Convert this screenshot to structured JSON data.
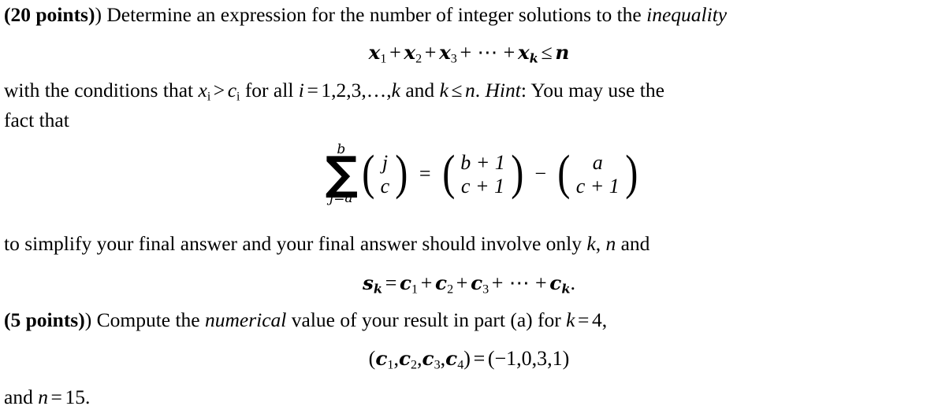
{
  "document": {
    "type": "math-problem-statement",
    "background_color": "#ffffff",
    "text_color": "#000000"
  },
  "part_a": {
    "points_label": "(20 points)",
    "points_bold_text": "20 points",
    "intro_before_emphasis": ") Determine an expression for the number of integer solutions to the ",
    "emphasis": "inequality",
    "inequality": {
      "terms": [
        "x",
        "x",
        "x"
      ],
      "subscripts": [
        "1",
        "2",
        "3"
      ],
      "ellipsis": "⋯",
      "last_term": "x",
      "last_subscript": "k",
      "relation": "≤",
      "bound": "n",
      "plain": "x₁ + x₂ + x₃ + ⋯ + xₖ ≤ n"
    },
    "conditions_line": {
      "segment_1": "with the conditions that ",
      "var_x": "x",
      "sub_x": "i",
      "rel_1": ">",
      "var_c": "c",
      "sub_c": "i",
      "segment_2": " for all ",
      "var_i": "i",
      "eq": "=",
      "index_list": "1,2,3,…,",
      "var_k": "k",
      "segment_3": " and ",
      "var_k2": "k",
      "rel_2": "≤",
      "var_n": "n",
      "period": ". ",
      "hint_label": "Hint",
      "segment_4": ": You may use the",
      "continuation": "fact that"
    },
    "identity": {
      "sum_upper": "b",
      "sum_lower": "j=a",
      "sigma": "∑",
      "left_binom": {
        "top": "j",
        "bottom": "c"
      },
      "equals": "=",
      "first_binom": {
        "top": "b + 1",
        "bottom": "c + 1"
      },
      "minus": "−",
      "second_binom": {
        "top": "a",
        "bottom": "c + 1"
      },
      "paren_open": "(",
      "paren_close": ")",
      "plain": "∑(j=a to b) C(j,c) = C(b+1, c+1) − C(a, c+1)"
    },
    "simplify_line": {
      "segment_1": "to simplify your final answer and your final answer should involve only ",
      "var_k": "k",
      "comma": ", ",
      "var_n": "n",
      "segment_2": " and"
    },
    "sk_definition": {
      "lhs_var": "s",
      "lhs_sub": "k",
      "eq": "=",
      "terms": [
        "c",
        "c",
        "c"
      ],
      "subscripts": [
        "1",
        "2",
        "3"
      ],
      "ellipsis": "⋯",
      "last_term": "c",
      "last_subscript": "k",
      "trailing": ".",
      "plain": "sₖ = c₁ + c₂ + c₃ + ⋯ + cₖ."
    }
  },
  "part_b": {
    "points_label": "(5 points)",
    "points_bold_text": "5 points",
    "segment_1": ") Compute the ",
    "emphasis": "numerical",
    "segment_2": " value of your result in part (a) for ",
    "var_k": "k",
    "eq": "=",
    "k_value": "4,",
    "tuple_equation": {
      "lhs_paren_open": "(",
      "lhs_vars": [
        "c",
        "c",
        "c",
        "c"
      ],
      "lhs_subs": [
        "1",
        "2",
        "3",
        "4"
      ],
      "lhs_paren_close": ")",
      "eq": "=",
      "rhs": "(−1,0,3,1)",
      "rhs_values": [
        "-1",
        "0",
        "3",
        "1"
      ],
      "plain": "(c₁,c₂,c₃,c₄) = (−1,0,3,1)"
    },
    "final_line": {
      "segment_1": "and ",
      "var_n": "n",
      "eq": "=",
      "n_value": "15."
    }
  }
}
